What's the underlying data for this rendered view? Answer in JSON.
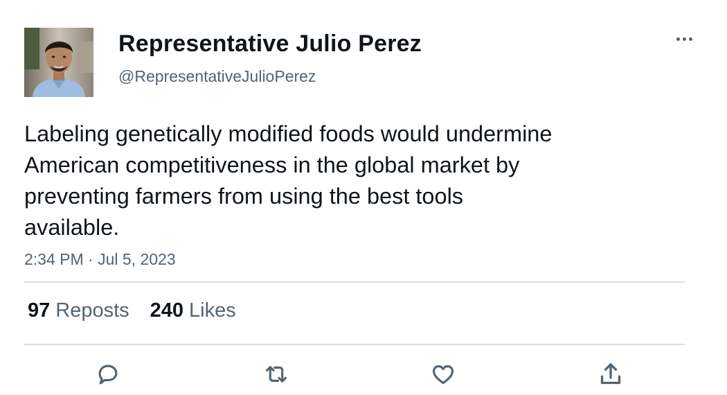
{
  "author": {
    "display_name": "Representative Julio Perez",
    "handle": "@RepresentativeJulioPerez"
  },
  "tweet": {
    "text": "Labeling genetically modified foods would undermine\nAmerican competitiveness in the global market by\npreventing farmers from using the best tools\navailable.",
    "timestamp": "2:34 PM · Jul 5, 2023"
  },
  "stats": {
    "reposts_count": "97",
    "reposts_label": "Reposts",
    "likes_count": "240",
    "likes_label": "Likes"
  },
  "icons": {
    "more": "more-horizontal-icon",
    "reply": "reply-icon",
    "repost": "repost-icon",
    "like": "heart-icon",
    "share": "share-icon"
  },
  "colors": {
    "text_primary": "#0f1419",
    "text_secondary": "#536471",
    "divider": "#dbdfe2"
  }
}
